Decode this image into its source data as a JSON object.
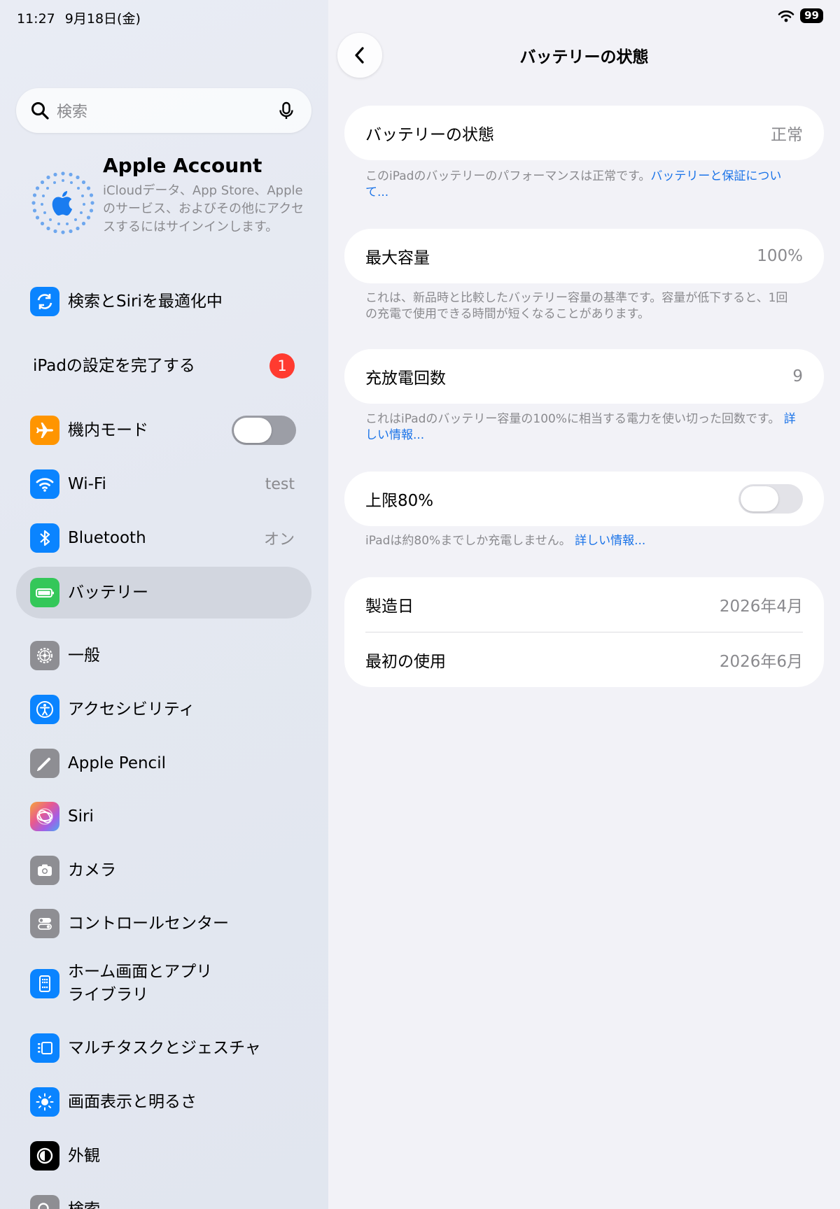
{
  "status": {
    "time": "11:27",
    "date": "9月18日(金)",
    "battery": "99"
  },
  "search": {
    "placeholder": "検索"
  },
  "account": {
    "name": "Apple Account",
    "description": "iCloudデータ、App Store、Appleのサービス、およびその他にアクセスするにはサインインします。"
  },
  "sidebar": {
    "siri_optimize": "検索とSiriを最適化中",
    "finish_setup": {
      "label": "iPadの設定を完了する",
      "badge": "1"
    },
    "items": [
      {
        "label": "機内モード",
        "icon": "airplane-icon",
        "color": "#ff9500",
        "toggle": false
      },
      {
        "label": "Wi-Fi",
        "icon": "wifi-icon",
        "color": "#0a84ff",
        "value": "test"
      },
      {
        "label": "Bluetooth",
        "icon": "bluetooth-icon",
        "color": "#0a84ff",
        "value": "オン"
      },
      {
        "label": "バッテリー",
        "icon": "battery-icon",
        "color": "#34c759",
        "selected": true
      },
      {
        "label": "一般",
        "icon": "gear-icon",
        "color": "#8e8e93"
      },
      {
        "label": "アクセシビリティ",
        "icon": "accessibility-icon",
        "color": "#0a84ff"
      },
      {
        "label": "Apple Pencil",
        "icon": "pencil-icon",
        "color": "#8e8e93"
      },
      {
        "label": "Siri",
        "icon": "siri-icon",
        "color": "#c86dd7"
      },
      {
        "label": "カメラ",
        "icon": "camera-icon",
        "color": "#8e8e93"
      },
      {
        "label": "コントロールセンター",
        "icon": "control-center-icon",
        "color": "#8e8e93"
      },
      {
        "label": "ホーム画面とアプリライブラリ",
        "label_line1": "ホーム画面とアプリ",
        "label_line2": "ライブラリ",
        "icon": "home-screen-icon",
        "color": "#0a84ff"
      },
      {
        "label": "マルチタスクとジェスチャ",
        "icon": "multitasking-icon",
        "color": "#0a84ff"
      },
      {
        "label": "画面表示と明るさ",
        "icon": "brightness-icon",
        "color": "#0a84ff"
      },
      {
        "label": "外観",
        "icon": "appearance-icon",
        "color": "#000000"
      },
      {
        "label": "検索",
        "icon": "search-icon",
        "color": "#8e8e93"
      }
    ]
  },
  "detail": {
    "title": "バッテリーの状態",
    "health": {
      "label": "バッテリーの状態",
      "value": "正常",
      "footer": "このiPadのバッテリーのパフォーマンスは正常です。",
      "footer_link": "バッテリーと保証について..."
    },
    "capacity": {
      "label": "最大容量",
      "value": "100%",
      "footer": "これは、新品時と比較したバッテリー容量の基準です。容量が低下すると、1回の充電で使用できる時間が短くなることがあります。"
    },
    "cycles": {
      "label": "充放電回数",
      "value": "9",
      "footer": "これはiPadのバッテリー容量の100%に相当する電力を使い切った回数です。",
      "footer_link": "詳しい情報..."
    },
    "limit": {
      "label": "上限80%",
      "enabled": false,
      "footer": "iPadは約80%までしか充電しません。",
      "footer_link": "詳しい情報..."
    },
    "dates": {
      "manufacture_label": "製造日",
      "manufacture_value": "2026年4月",
      "first_use_label": "最初の使用",
      "first_use_value": "2026年6月"
    }
  }
}
